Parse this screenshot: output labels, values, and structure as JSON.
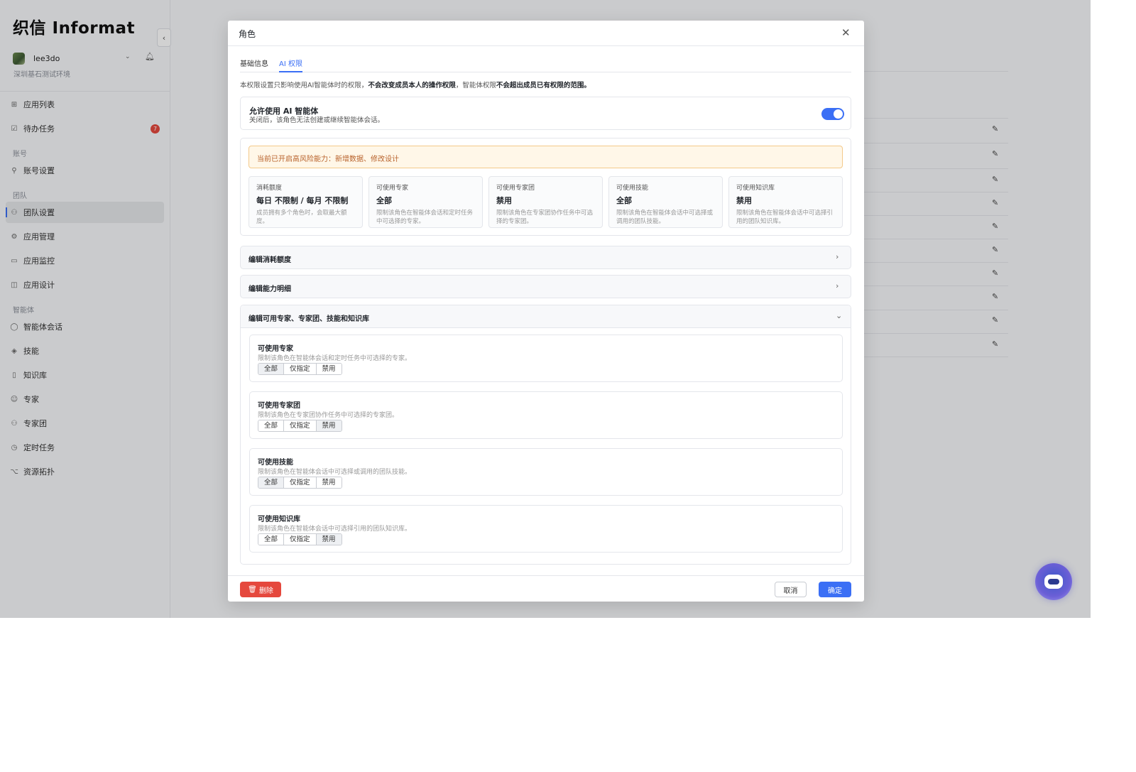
{
  "sidebar": {
    "logo": "织信 Informat",
    "collapse_icon": "‹",
    "user": {
      "name": "lee3do",
      "env": "深圳基石测试环境"
    },
    "items": [
      {
        "label": "应用列表",
        "icon": "⊞"
      },
      {
        "label": "待办任务",
        "icon": "☑",
        "badge": "7"
      },
      {
        "label": "账号设置",
        "icon": "⚲"
      },
      {
        "label": "团队设置",
        "icon": "⚇"
      },
      {
        "label": "应用管理",
        "icon": "⚙"
      },
      {
        "label": "应用监控",
        "icon": "▭"
      },
      {
        "label": "应用设计",
        "icon": "◫"
      },
      {
        "label": "智能体会话",
        "icon": "◯"
      },
      {
        "label": "技能",
        "icon": "◈"
      },
      {
        "label": "知识库",
        "icon": "▯"
      },
      {
        "label": "专家",
        "icon": "☺"
      },
      {
        "label": "专家团",
        "icon": "⚇"
      },
      {
        "label": "定时任务",
        "icon": "◷"
      },
      {
        "label": "资源拓扑",
        "icon": "⌥"
      }
    ],
    "groups": [
      "账号",
      "团队",
      "智能体"
    ]
  },
  "modal": {
    "title": "角色",
    "tabs": [
      "基础信息",
      "AI 权限"
    ],
    "notice_a": "本权限设置只影响使用AI智能体时的权限，",
    "notice_b": "不会改变成员本人的操作权限",
    "notice_c": "，智能体权限",
    "notice_d": "不会超出成员已有权限的范围。",
    "allow": {
      "title": "允许使用 AI 智能体",
      "desc": "关闭后，该角色无法创建或继续智能体会话。",
      "enabled": true
    },
    "warning": "当前已开启高风险能力：新增数据、修改设计",
    "cards": [
      {
        "label": "消耗额度",
        "value": "每日 不限制 / 每月 不限制",
        "desc": "成员拥有多个角色时，会取最大额度。"
      },
      {
        "label": "可使用专家",
        "value": "全部",
        "desc": "限制该角色在智能体会话和定时任务中可选择的专家。"
      },
      {
        "label": "可使用专家团",
        "value": "禁用",
        "desc": "限制该角色在专家团协作任务中可选择的专家团。"
      },
      {
        "label": "可使用技能",
        "value": "全部",
        "desc": "限制该角色在智能体会话中可选择或调用的团队技能。"
      },
      {
        "label": "可使用知识库",
        "value": "禁用",
        "desc": "限制该角色在智能体会话中可选择引用的团队知识库。"
      }
    ],
    "accordions": [
      "编辑消耗额度",
      "编辑能力明细",
      "编辑可用专家、专家团、技能和知识库"
    ],
    "options": [
      "全部",
      "仅指定",
      "禁用"
    ],
    "permissions": [
      {
        "title": "可使用专家",
        "desc": "限制该角色在智能体会话和定时任务中可选择的专家。",
        "selected": "全部"
      },
      {
        "title": "可使用专家团",
        "desc": "限制该角色在专家团协作任务中可选择的专家团。",
        "selected": "禁用"
      },
      {
        "title": "可使用技能",
        "desc": "限制该角色在智能体会话中可选择或调用的团队技能。",
        "selected": "全部"
      },
      {
        "title": "可使用知识库",
        "desc": "限制该角色在智能体会话中可选择引用的团队知识库。",
        "selected": "禁用"
      }
    ],
    "delete_label": "删除",
    "cancel_label": "取消",
    "ok_label": "确定"
  },
  "colors": {
    "accent": "#3b6ff5",
    "danger": "#e5483d",
    "warning_text": "#b8622b"
  }
}
